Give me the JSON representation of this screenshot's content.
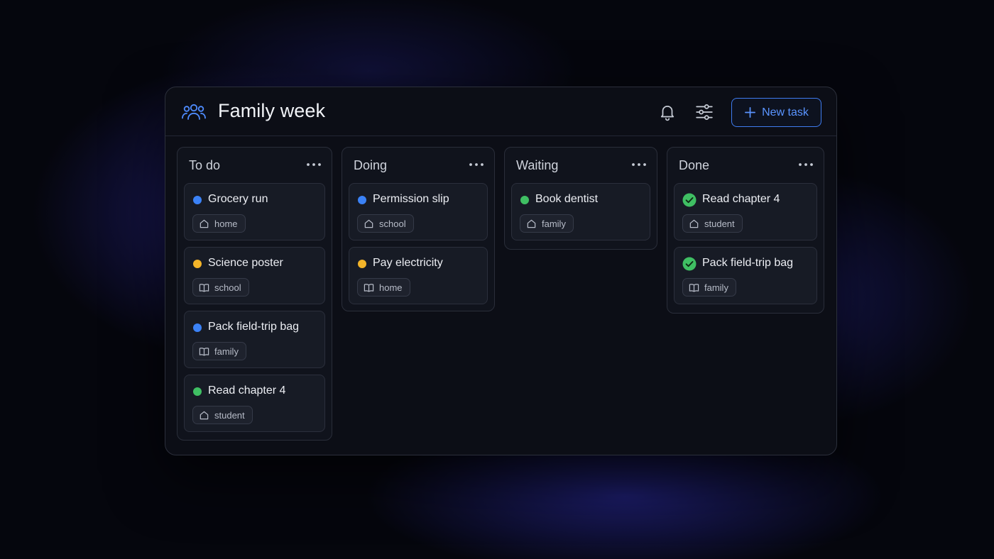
{
  "app": {
    "title": "Family week",
    "icon": "family-icon",
    "new_task_label": "New task",
    "accent": "#3f7cf0"
  },
  "header_icons": [
    "bell-icon",
    "sliders-icon",
    "plus-icon"
  ],
  "status_colors": {
    "blue": "#3b82f6",
    "yellow": "#f3b429",
    "green": "#3fbf63"
  },
  "columns": [
    {
      "title": "To do",
      "cards": [
        {
          "title": "Grocery run",
          "status": "blue",
          "tag": "home",
          "tag_icon": "house-icon"
        },
        {
          "title": "Science poster",
          "status": "yellow",
          "tag": "school",
          "tag_icon": "book-icon"
        },
        {
          "title": "Pack field-trip bag",
          "status": "blue",
          "tag": "family",
          "tag_icon": "book-icon"
        },
        {
          "title": "Read chapter 4",
          "status": "green",
          "tag": "student",
          "tag_icon": "house-icon"
        }
      ]
    },
    {
      "title": "Doing",
      "cards": [
        {
          "title": "Permission slip",
          "status": "blue",
          "tag": "school",
          "tag_icon": "house-icon"
        },
        {
          "title": "Pay electricity",
          "status": "yellow",
          "tag": "home",
          "tag_icon": "book-icon"
        }
      ]
    },
    {
      "title": "Waiting",
      "cards": [
        {
          "title": "Book dentist",
          "status": "green",
          "tag": "family",
          "tag_icon": "house-icon"
        }
      ]
    },
    {
      "title": "Done",
      "cards": [
        {
          "title": "Read chapter 4",
          "status": "done",
          "tag": "student",
          "tag_icon": "house-icon"
        },
        {
          "title": "Pack field-trip bag",
          "status": "done",
          "tag": "family",
          "tag_icon": "book-icon"
        }
      ]
    }
  ]
}
